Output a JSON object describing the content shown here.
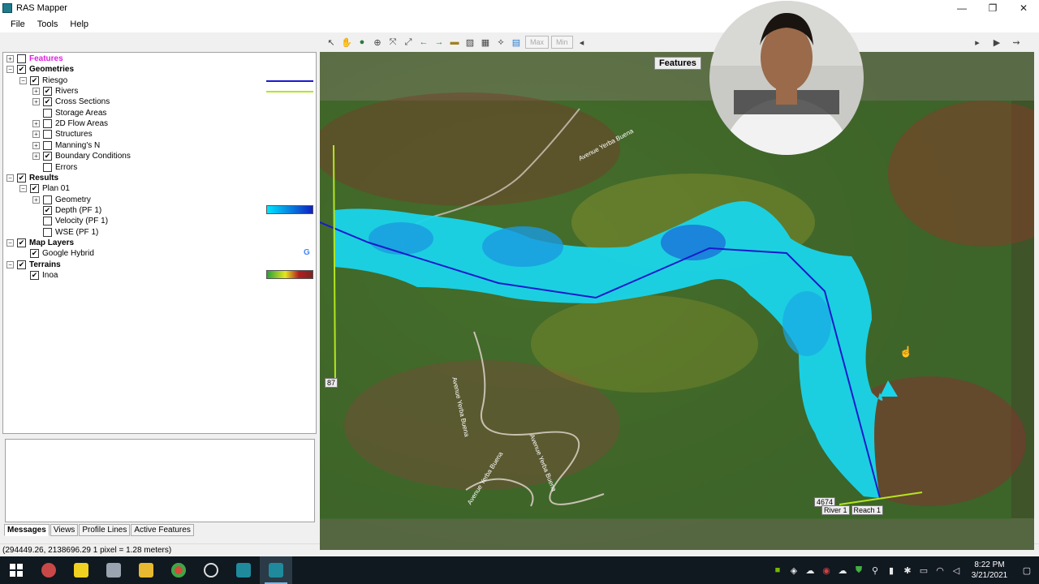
{
  "window": {
    "title": "RAS Mapper",
    "minimize": "—",
    "maximize": "❐",
    "close": "✕"
  },
  "menu": [
    "File",
    "Tools",
    "Help"
  ],
  "toolbar": {
    "max_label": "Max",
    "min_label": "Min"
  },
  "tree": [
    {
      "label": "Features",
      "checked": false,
      "expander": "+",
      "bold": true,
      "color": "#e020e0"
    },
    {
      "label": "Geometries",
      "checked": true,
      "expander": "−",
      "bold": true
    },
    {
      "label": "Riesgo",
      "checked": true,
      "expander": "−"
    },
    {
      "label": "Rivers",
      "checked": true,
      "expander": "+"
    },
    {
      "label": "Cross Sections",
      "checked": true,
      "expander": "+"
    },
    {
      "label": "Storage Areas",
      "checked": false,
      "expander": ""
    },
    {
      "label": "2D Flow Areas",
      "checked": false,
      "expander": "+"
    },
    {
      "label": "Structures",
      "checked": false,
      "expander": "+"
    },
    {
      "label": "Manning's N",
      "checked": false,
      "expander": "+"
    },
    {
      "label": "Boundary Conditions",
      "checked": true,
      "expander": "+"
    },
    {
      "label": "Errors",
      "checked": false,
      "expander": ""
    },
    {
      "label": "Results",
      "checked": true,
      "expander": "−",
      "bold": true
    },
    {
      "label": "Plan 01",
      "checked": true,
      "expander": "−"
    },
    {
      "label": "Geometry",
      "checked": false,
      "expander": "+"
    },
    {
      "label": "Depth (PF 1)",
      "checked": true,
      "expander": ""
    },
    {
      "label": "Velocity (PF 1)",
      "checked": false,
      "expander": ""
    },
    {
      "label": "WSE (PF 1)",
      "checked": false,
      "expander": ""
    },
    {
      "label": "Map Layers",
      "checked": true,
      "expander": "−",
      "bold": true
    },
    {
      "label": "Google Hybrid",
      "checked": true,
      "expander": ""
    },
    {
      "label": "Terrains",
      "checked": true,
      "expander": "−",
      "bold": true
    },
    {
      "label": "Inoa",
      "checked": true,
      "expander": ""
    }
  ],
  "legend_colors": {
    "rivers": "#1a1acc",
    "cross_sections": "#b4e61e"
  },
  "google_badge": "G",
  "tabs": [
    "Messages",
    "Views",
    "Profile Lines",
    "Active Features"
  ],
  "status": "(294449.26, 2138696.29  1 pixel = 1.28 meters)",
  "map": {
    "features_label": "Features",
    "xs_label_top": "87",
    "xs_label_bottom": "4674",
    "river_label_1": "River 1",
    "river_label_2": "Reach 1",
    "roads": [
      "Avenue Yerba Buena",
      "Avenue Yerba Buena",
      "Avenue Yerba Buena",
      "Avenue Yerba Buena"
    ]
  },
  "taskbar": {
    "time": "8:22 PM",
    "date": "3/21/2021"
  }
}
